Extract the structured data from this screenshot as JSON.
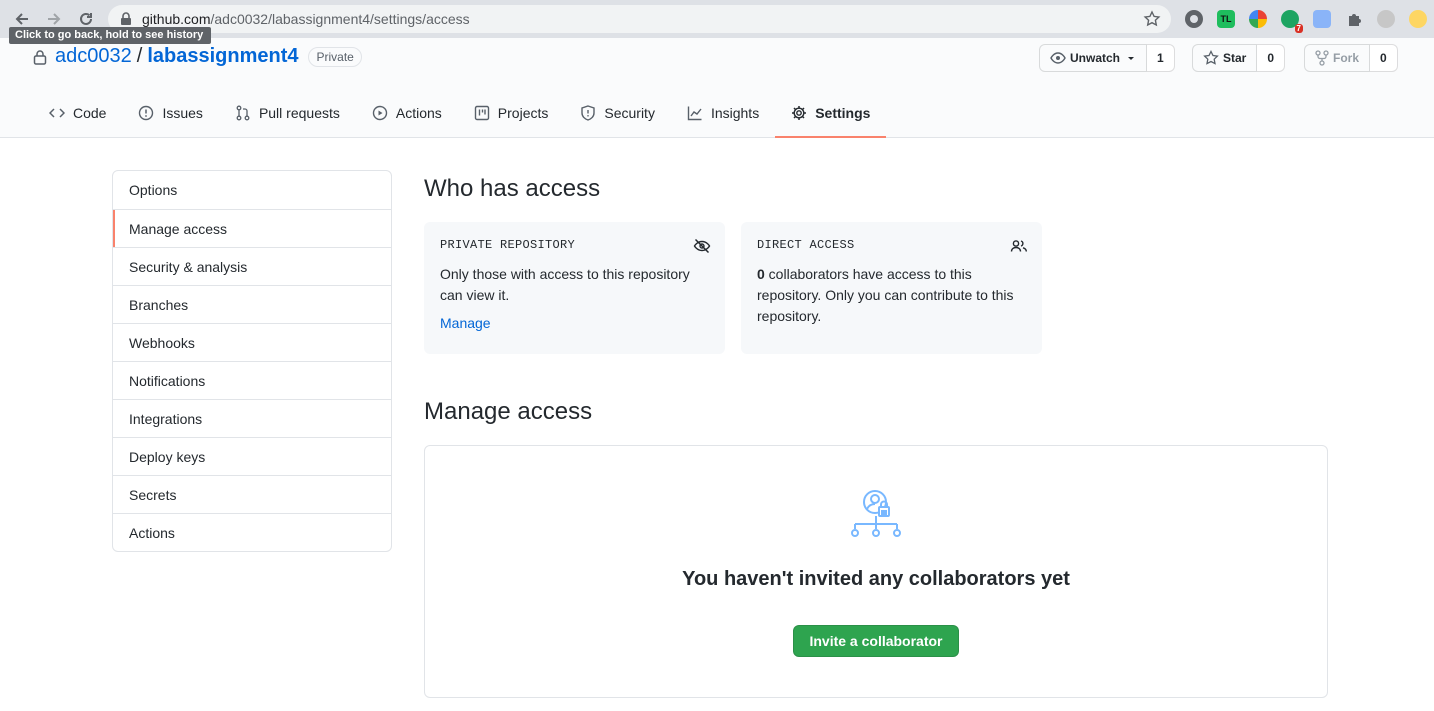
{
  "browser": {
    "url_host": "github.com",
    "url_path": "/adc0032/labassignment4/settings/access",
    "tooltip": "Click to go back, hold to see history",
    "extension_badge": "7",
    "extension_tl_label": "TL"
  },
  "repo": {
    "owner": "adc0032",
    "separator": "/",
    "name": "labassignment4",
    "visibility_badge": "Private"
  },
  "actions": {
    "watch": {
      "label": "Unwatch",
      "count": "1"
    },
    "star": {
      "label": "Star",
      "count": "0"
    },
    "fork": {
      "label": "Fork",
      "count": "0"
    }
  },
  "tabs": [
    {
      "label": "Code",
      "icon": "code-icon"
    },
    {
      "label": "Issues",
      "icon": "issue-icon"
    },
    {
      "label": "Pull requests",
      "icon": "pull-request-icon"
    },
    {
      "label": "Actions",
      "icon": "play-icon"
    },
    {
      "label": "Projects",
      "icon": "project-icon"
    },
    {
      "label": "Security",
      "icon": "shield-icon"
    },
    {
      "label": "Insights",
      "icon": "graph-icon"
    },
    {
      "label": "Settings",
      "icon": "gear-icon",
      "selected": true
    }
  ],
  "sidebar": {
    "items": [
      {
        "label": "Options"
      },
      {
        "label": "Manage access",
        "selected": true
      },
      {
        "label": "Security & analysis"
      },
      {
        "label": "Branches"
      },
      {
        "label": "Webhooks"
      },
      {
        "label": "Notifications"
      },
      {
        "label": "Integrations"
      },
      {
        "label": "Deploy keys"
      },
      {
        "label": "Secrets"
      },
      {
        "label": "Actions"
      }
    ]
  },
  "who_has_access": {
    "heading": "Who has access",
    "private_box": {
      "title": "PRIVATE REPOSITORY",
      "text": "Only those with access to this repository can view it.",
      "link": "Manage"
    },
    "direct_box": {
      "title": "DIRECT ACCESS",
      "count": "0",
      "text": " collaborators have access to this repository. Only you can contribute to this repository."
    }
  },
  "manage_access": {
    "heading": "Manage access",
    "empty_message": "You haven't invited any collaborators yet",
    "invite_button": "Invite a collaborator"
  },
  "colors": {
    "link": "#0366d6",
    "selected_underline": "#f9826c",
    "primary_button": "#2ea44f",
    "illustration": "#79b8ff"
  }
}
